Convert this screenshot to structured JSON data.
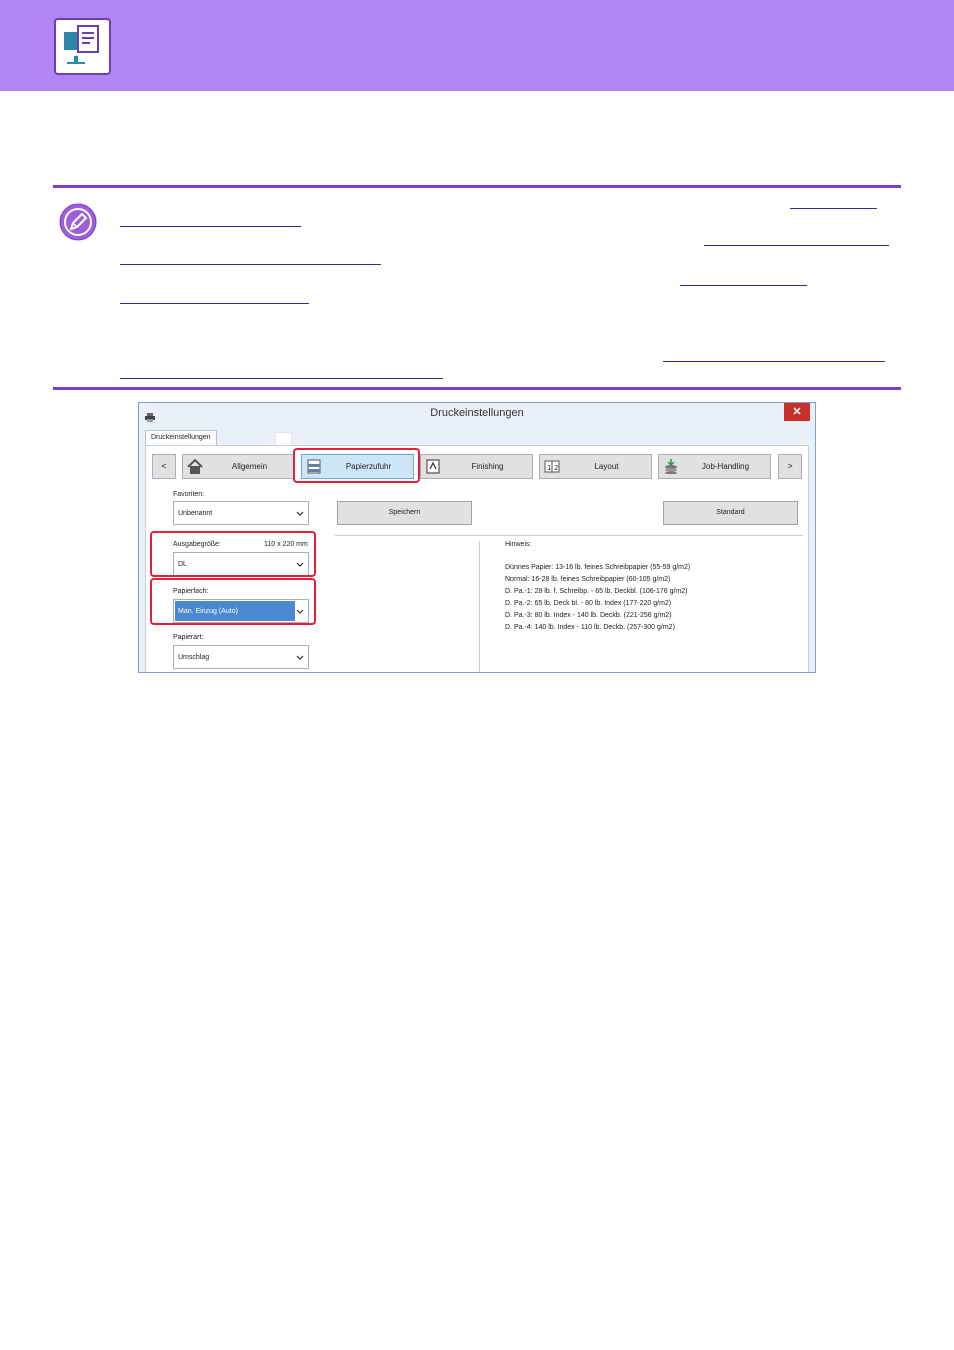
{
  "banner": {
    "icon": "document-computer-icon",
    "color": "#b286f2"
  },
  "note": {
    "icon": "pencil-note-icon"
  },
  "dialog": {
    "title": "Druckeinstellungen",
    "close_label": "✕",
    "tab_label": "Druckeinstellungen",
    "nav": {
      "prev_label": "<",
      "next_label": ">",
      "tabs": [
        {
          "label": "Allgemein",
          "icon": "home-icon"
        },
        {
          "label": "Papierzufuhr",
          "icon": "paper-tray-icon"
        },
        {
          "label": "Finishing",
          "icon": "finishing-icon"
        },
        {
          "label": "Layout",
          "icon": "layout-icon"
        },
        {
          "label": "Job-Handling",
          "icon": "job-handling-icon"
        }
      ]
    },
    "favorites": {
      "label": "Favoriten:",
      "value": "Unbenannt"
    },
    "save_label": "Speichern",
    "standard_label": "Standard",
    "output_size": {
      "label": "Ausgabegröße:",
      "dimensions": "110 x 220 mm",
      "value": "DL"
    },
    "paper_tray": {
      "label": "Papierfach:",
      "value": "Man. Einzug (Auto)"
    },
    "paper_type": {
      "label": "Papierart:",
      "value": "Umschlag"
    },
    "hint": {
      "title": "Hinweis:",
      "lines": [
        "Dünnes Papier: 13-16 lb. feines Schreibpapier (55-59 g/m2)",
        "Normal: 16-28 lb. feines Schreibpapier (60-105 g/m2)",
        "D. Pa.-1: 28 lb. f. Schreibp. - 65 lb. Deckbl. (106-176 g/m2)",
        "D. Pa.-2: 65 lb. Deck bl. - 80 lb. Index (177-220 g/m2)",
        "D. Pa.-3: 80 lb. Index - 140 lb. Deckb. (221-256 g/m2)",
        "D. Pa.-4: 140 lb. Index - 110 lb. Deckb. (257-300 g/m2)"
      ]
    }
  }
}
